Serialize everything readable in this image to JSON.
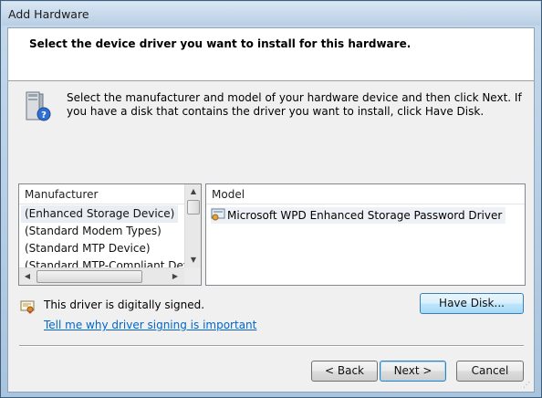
{
  "window": {
    "title": "Add Hardware"
  },
  "header": {
    "text": "Select the device driver you want to install for this hardware."
  },
  "intro": {
    "text": "Select the manufacturer and model of your hardware device and then click Next. If you have a disk that contains the driver you want to install, click Have Disk."
  },
  "manufacturer_list": {
    "header": "Manufacturer",
    "items": [
      {
        "label": "(Enhanced Storage Device)",
        "selected": true
      },
      {
        "label": "(Standard Modem Types)"
      },
      {
        "label": "(Standard MTP Device)"
      },
      {
        "label": "(Standard MTP-Compliant Devic"
      }
    ]
  },
  "model_list": {
    "header": "Model",
    "items": [
      {
        "label": "Microsoft WPD Enhanced Storage Password Driver",
        "icon": "driver-icon"
      }
    ]
  },
  "signature": {
    "status": "This driver is digitally signed.",
    "link": "Tell me why driver signing is important",
    "icon": "certificate-icon"
  },
  "buttons": {
    "have_disk": "Have Disk...",
    "back": "< Back",
    "next": "Next >",
    "cancel": "Cancel"
  },
  "colors": {
    "link": "#0066cc",
    "accent": "#3c7fb1"
  }
}
